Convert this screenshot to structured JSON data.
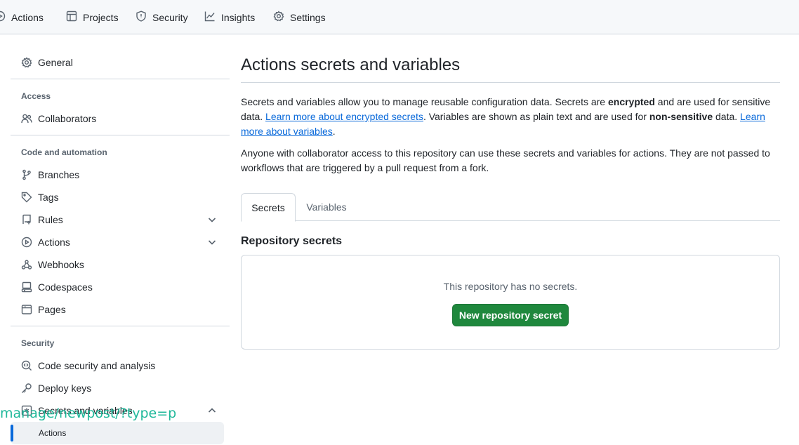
{
  "topnav": {
    "items": [
      {
        "label": "Actions",
        "icon": "play-circle-icon"
      },
      {
        "label": "Projects",
        "icon": "table-icon"
      },
      {
        "label": "Security",
        "icon": "shield-icon"
      },
      {
        "label": "Insights",
        "icon": "graph-icon"
      },
      {
        "label": "Settings",
        "icon": "gear-icon"
      }
    ]
  },
  "sidebar": {
    "general": "General",
    "access_heading": "Access",
    "collaborators": "Collaborators",
    "code_heading": "Code and automation",
    "branches": "Branches",
    "tags": "Tags",
    "rules": "Rules",
    "actions": "Actions",
    "webhooks": "Webhooks",
    "codespaces": "Codespaces",
    "pages": "Pages",
    "security_heading": "Security",
    "code_security": "Code security and analysis",
    "deploy_keys": "Deploy keys",
    "secrets_vars": "Secrets and variables",
    "sub_actions": "Actions"
  },
  "overlay": {
    "url_text": "manage/newpost/?type=p"
  },
  "main": {
    "title": "Actions secrets and variables",
    "desc1": {
      "part1": "Secrets and variables allow you to manage reusable configuration data. Secrets are ",
      "bold1": "encrypted",
      "part2": " and are used for sensitive data. ",
      "link1": "Learn more about encrypted secrets",
      "part3": ". Variables are shown as plain text and are used for ",
      "bold2": "non-sensitive",
      "part4": " data. ",
      "link2": "Learn more about variables",
      "part5": "."
    },
    "desc2": "Anyone with collaborator access to this repository can use these secrets and variables for actions. They are not passed to workflows that are triggered by a pull request from a fork.",
    "tabs": [
      {
        "label": "Secrets",
        "active": true
      },
      {
        "label": "Variables",
        "active": false
      }
    ],
    "section_title": "Repository secrets",
    "empty_text": "This repository has no secrets.",
    "new_button": "New repository secret"
  },
  "colors": {
    "accent_blue": "#0969da",
    "button_green": "#1f883d",
    "overlay_text": "#1fb89a"
  }
}
